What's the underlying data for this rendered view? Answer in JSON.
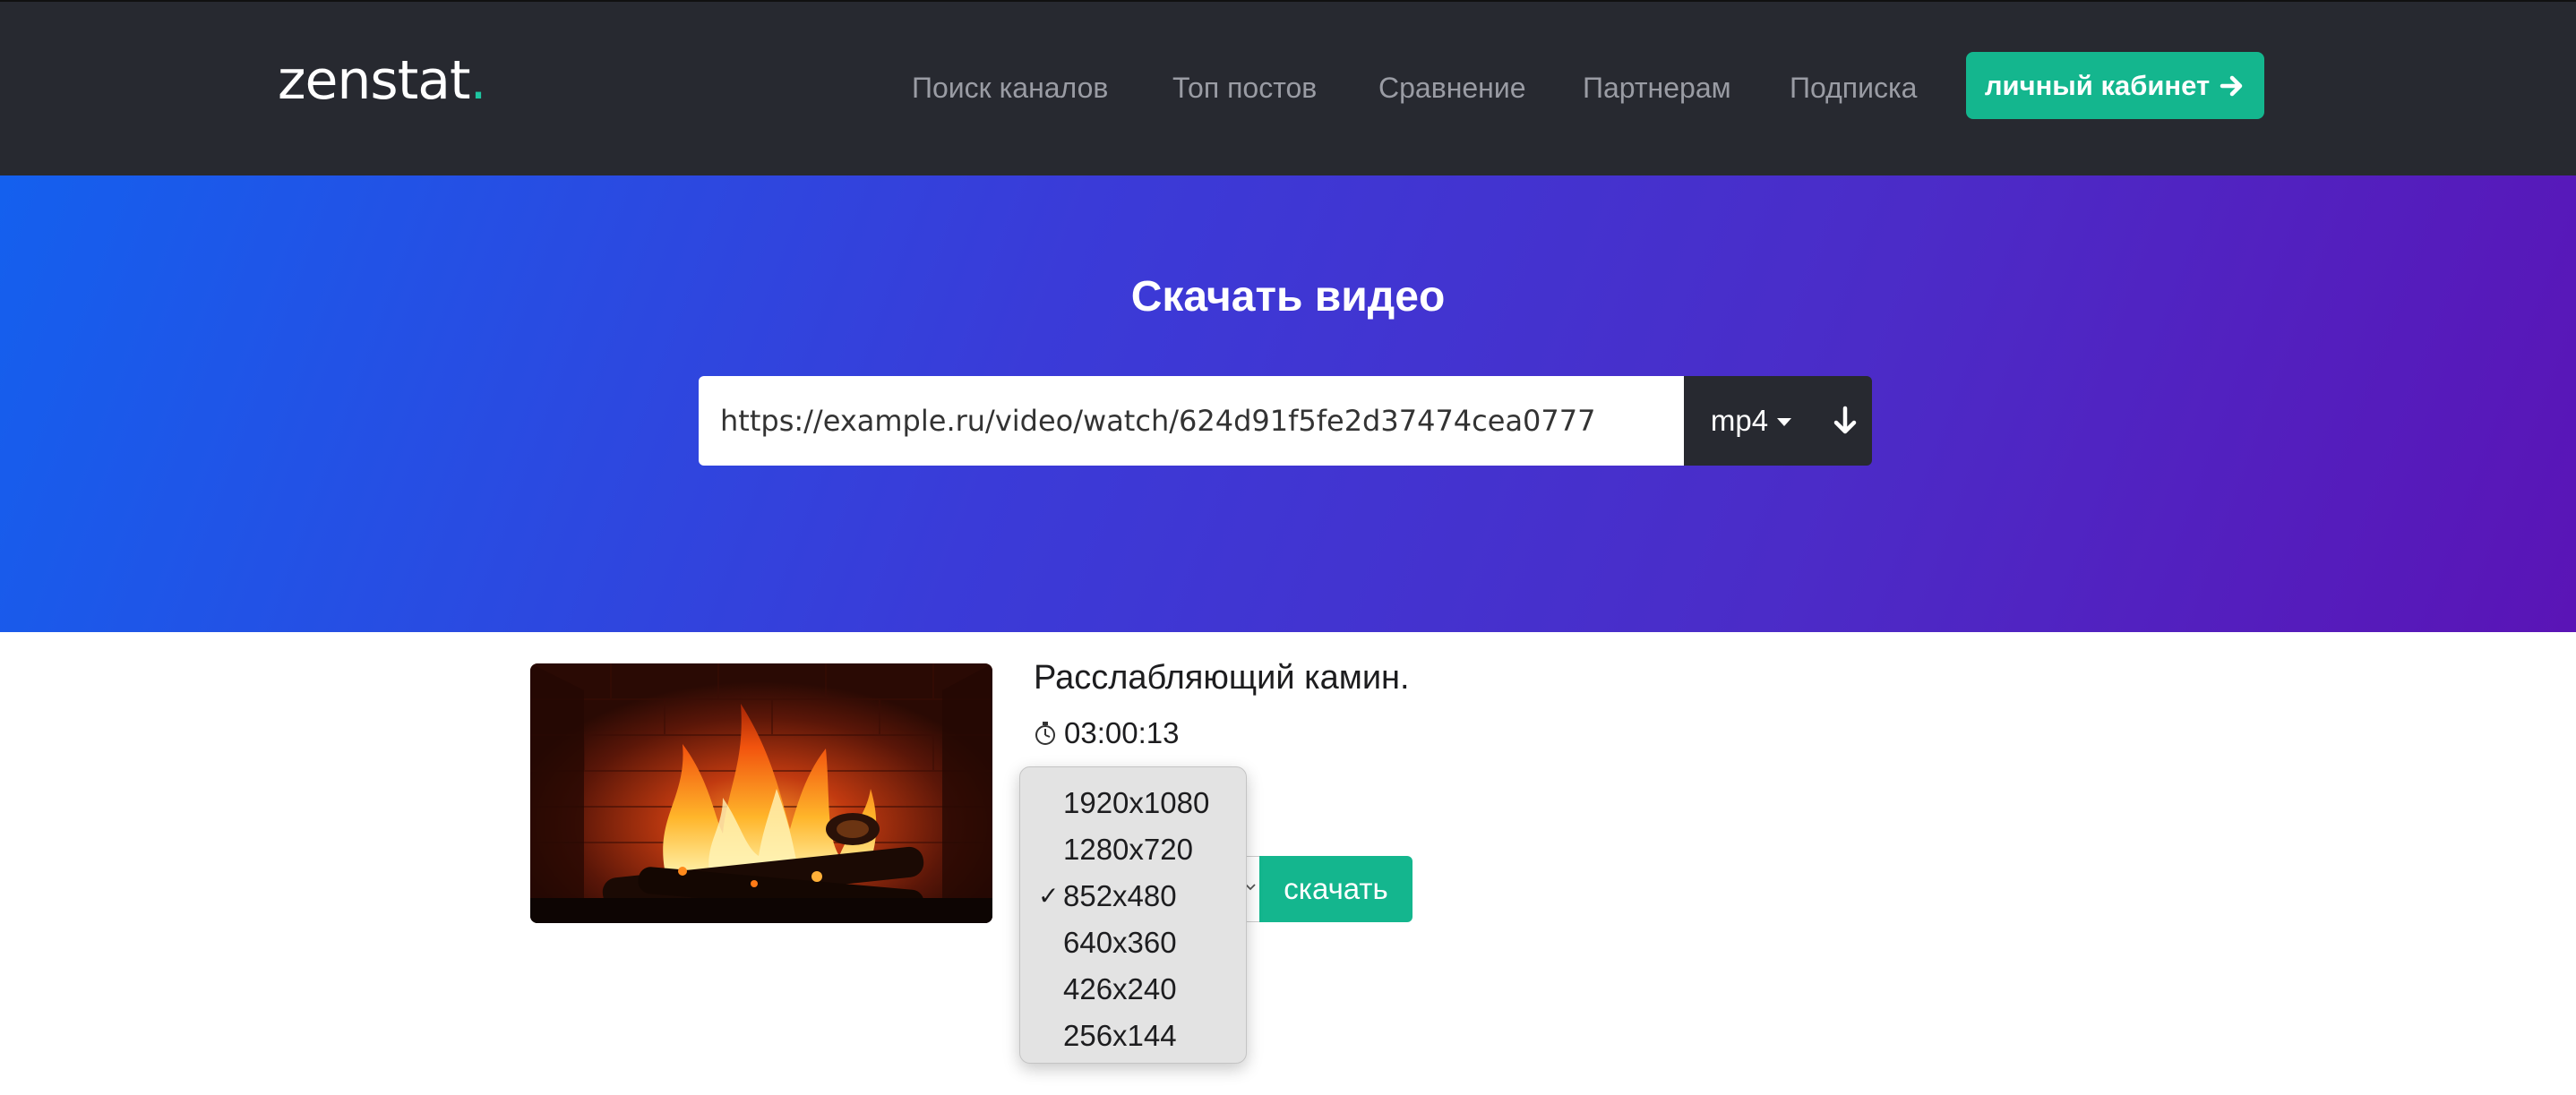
{
  "brand": {
    "logo_text": "zenstat",
    "logo_dot": ".",
    "accent": "#14b68e",
    "dark": "#272930"
  },
  "nav": {
    "links": [
      "Поиск каналов",
      "Топ постов",
      "Сравнение",
      "Партнерам",
      "Подписка"
    ],
    "cabinet_label": "личный кабинет",
    "cabinet_icon": "arrow-right-icon"
  },
  "hero": {
    "title": "Скачать видео",
    "url_value": "https://example.ru/video/watch/624d91f5fe2d37474cea0777",
    "format_label": "mp4",
    "format_icon": "caret-down-icon",
    "go_icon": "arrow-down-icon"
  },
  "video": {
    "title": "Расслабляющий камин.",
    "duration_icon": "stopwatch-icon",
    "duration": "03:00:13",
    "download_label": "скачать"
  },
  "resolution_dropdown": {
    "options": [
      "1920x1080",
      "1280x720",
      "852x480",
      "640x360",
      "426x240",
      "256x144"
    ],
    "selected": "852x480",
    "check_mark": "✓"
  }
}
